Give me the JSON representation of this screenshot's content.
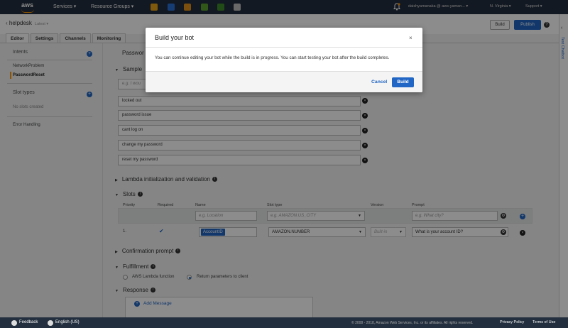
{
  "topnav": {
    "logo": "aws",
    "services": "Services",
    "resource_groups": "Resource Groups",
    "user": "daishyamanaka @ aws-yaman...",
    "region": "N. Virginia",
    "support": "Support"
  },
  "header": {
    "bot_name": "helpdesk",
    "version": "Latest",
    "build_label": "Build",
    "publish_label": "Publish",
    "tabs": [
      "Editor",
      "Settings",
      "Channels",
      "Monitoring"
    ]
  },
  "rail": {
    "label": "Test Chatbot"
  },
  "sidebar": {
    "intents_title": "Intents",
    "intents": [
      "NetworkProblem",
      "PasswordReset"
    ],
    "slot_types_title": "Slot types",
    "slot_types_empty": "No slots created",
    "error_handling": "Error Handling"
  },
  "editor": {
    "intent_title": "Passwor",
    "sample_title": "Sample",
    "utterance_placeholder": "e.g. I wou",
    "utterances": [
      "locked out",
      "password issue",
      "cant log on",
      "change my password",
      "reset my password"
    ],
    "lambda_section": "Lambda initialization and validation",
    "slots_section": "Slots",
    "slot_headers": {
      "priority": "Priority",
      "required": "Required",
      "name": "Name",
      "slot_type": "Slot type",
      "version": "Version",
      "prompt": "Prompt"
    },
    "new_slot": {
      "name_placeholder": "e.g. Location",
      "type_placeholder": "e.g. AMAZON.US_CITY",
      "prompt_placeholder": "e.g. What city?"
    },
    "slot_row": {
      "priority": "1.",
      "name": "AccountID",
      "type": "AMAZON.NUMBER",
      "version": "Built-in",
      "prompt": "What is your account ID?"
    },
    "confirmation_section": "Confirmation prompt",
    "fulfillment_section": "Fulfillment",
    "fulfillment_options": [
      "AWS Lambda function",
      "Return parameters to client"
    ],
    "response_section": "Response",
    "add_message": "Add Message"
  },
  "modal": {
    "title": "Build your bot",
    "body": "You can continue editing your bot while the build is in progress. You can start testing your bot after the build completes.",
    "cancel": "Cancel",
    "build": "Build"
  },
  "footer": {
    "feedback": "Feedback",
    "language": "English (US)",
    "copyright": "© 2008 - 2018, Amazon Web Services, Inc. or its affiliates. All rights reserved.",
    "privacy": "Privacy Policy",
    "terms": "Terms of Use"
  },
  "colors": {
    "accent": "#2166c4",
    "nav": "#232f3e",
    "orange": "#ff9900"
  }
}
